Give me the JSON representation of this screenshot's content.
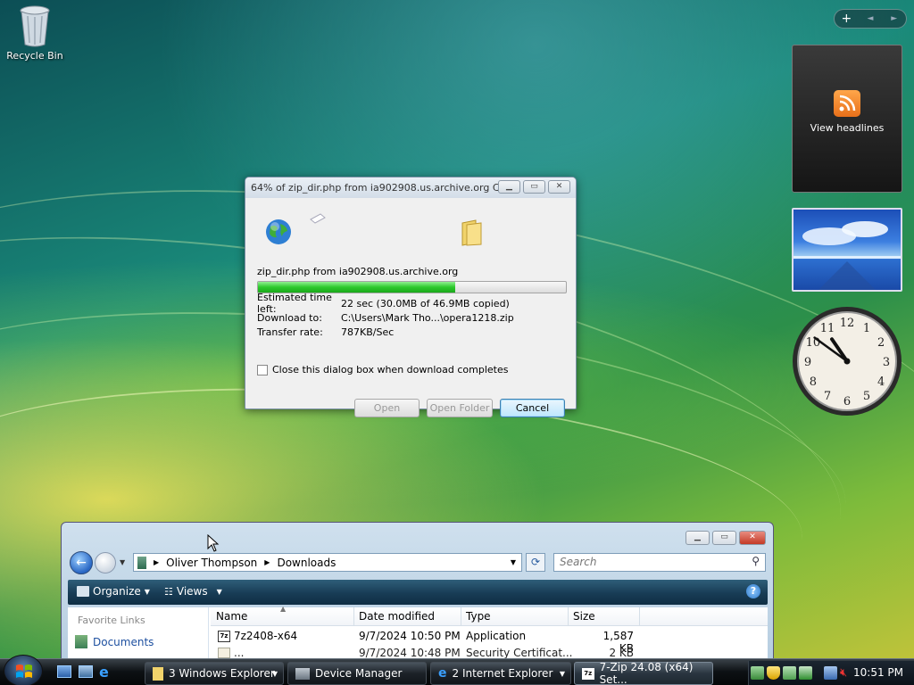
{
  "desktop": {
    "recycle_bin_label": "Recycle Bin"
  },
  "sidebar": {
    "add_label": "+",
    "prev_label": "◄",
    "next_label": "►",
    "feed_gadget_label": "View headlines",
    "clock": {
      "hour": 10,
      "minute": 51
    }
  },
  "download_dialog": {
    "title": "64% of zip_dir.php from ia902908.us.archive.org C...",
    "filename_line": "zip_dir.php from ia902908.us.archive.org",
    "progress": 0.64,
    "estimated_time_label": "Estimated time left:",
    "estimated_time_value": "22 sec (30.0MB of 46.9MB copied)",
    "download_to_label": "Download to:",
    "download_to_value": "C:\\Users\\Mark Tho...\\opera1218.zip",
    "transfer_rate_label": "Transfer rate:",
    "transfer_rate_value": "787KB/Sec",
    "close_checkbox_label": "Close this dialog box when download completes",
    "open_button": "Open",
    "open_folder_button": "Open Folder",
    "cancel_button": "Cancel"
  },
  "explorer": {
    "breadcrumb": [
      "Oliver Thompson",
      "Downloads"
    ],
    "search_placeholder": "Search",
    "organize_label": "Organize",
    "views_label": "Views",
    "help_label": "?",
    "favorite_links_label": "Favorite Links",
    "documents_link": "Documents",
    "columns": {
      "name": "Name",
      "date_modified": "Date modified",
      "type": "Type",
      "size": "Size"
    },
    "rows": [
      {
        "name": "7z2408-x64",
        "date": "9/7/2024 10:50 PM",
        "type": "Application",
        "size": "1,587 KB"
      },
      {
        "name": "...",
        "date": "9/7/2024 10:48 PM",
        "type": "Security Certificat...",
        "size": "2 KB"
      }
    ]
  },
  "taskbar": {
    "buttons": [
      {
        "label": "3 Windows Explorer",
        "has_menu": true
      },
      {
        "label": "Device Manager",
        "has_menu": false
      },
      {
        "label": "2 Internet Explorer",
        "has_menu": true
      },
      {
        "label": "7-Zip 24.08 (x64) Set...",
        "has_menu": false
      }
    ],
    "clock": "10:51 PM"
  },
  "colors": {
    "progress_fill": "#2cc92c",
    "command_bar": "#183c55",
    "link": "#1e50a0"
  }
}
